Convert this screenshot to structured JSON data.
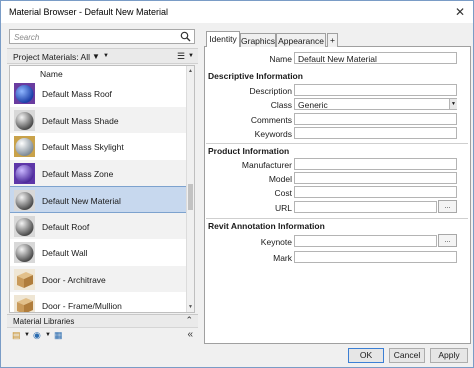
{
  "window": {
    "title": "Material Browser - Default New Material",
    "close_icon": "close-icon"
  },
  "search": {
    "placeholder": "Search"
  },
  "project_bar": {
    "label": "Project Materials: All"
  },
  "list": {
    "column_header": "Name",
    "items": [
      {
        "name": "Default Mass Roof",
        "thumb": "blue-sphere"
      },
      {
        "name": "Default Mass Shade",
        "thumb": "gray-sphere"
      },
      {
        "name": "Default Mass Skylight",
        "thumb": "glass-sphere"
      },
      {
        "name": "Default Mass Zone",
        "thumb": "purple-sphere"
      },
      {
        "name": "Default New Material",
        "thumb": "gray-sphere",
        "selected": true
      },
      {
        "name": "Default Roof",
        "thumb": "gray-sphere"
      },
      {
        "name": "Default Wall",
        "thumb": "gray-sphere"
      },
      {
        "name": "Door - Architrave",
        "thumb": "wood-block"
      },
      {
        "name": "Door - Frame/Mullion",
        "thumb": "wood-block"
      }
    ]
  },
  "libraries": {
    "label": "Material Libraries"
  },
  "tabs": [
    {
      "label": "Identity",
      "active": true
    },
    {
      "label": "Graphics"
    },
    {
      "label": "Appearance"
    },
    {
      "label": "+"
    }
  ],
  "identity": {
    "name_label": "Name",
    "name_value": "Default New Material",
    "descriptive_header": "Descriptive Information",
    "description_label": "Description",
    "description_value": "",
    "class_label": "Class",
    "class_value": "Generic",
    "comments_label": "Comments",
    "comments_value": "",
    "keywords_label": "Keywords",
    "keywords_value": "",
    "product_header": "Product Information",
    "manufacturer_label": "Manufacturer",
    "manufacturer_value": "",
    "model_label": "Model",
    "model_value": "",
    "cost_label": "Cost",
    "cost_value": "",
    "url_label": "URL",
    "url_value": "",
    "browse_label": "...",
    "revit_header": "Revit Annotation Information",
    "keynote_label": "Keynote",
    "keynote_value": "",
    "mark_label": "Mark",
    "mark_value": ""
  },
  "footer": {
    "ok": "OK",
    "cancel": "Cancel",
    "apply": "Apply"
  },
  "colors": {
    "selection": "#c7d8ee",
    "accent": "#3c7fd4"
  }
}
